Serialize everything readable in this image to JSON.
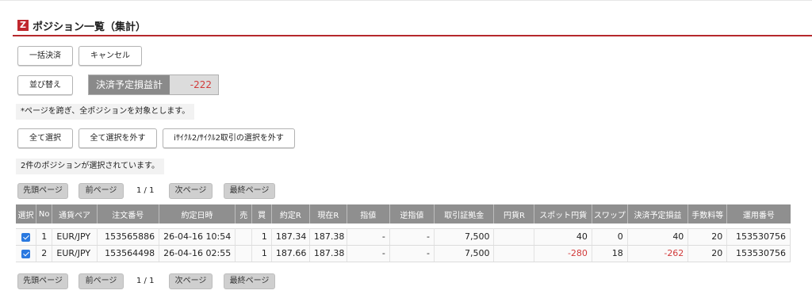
{
  "title": "ポジション一覧（集計）",
  "logo_letter": "Z",
  "buttons": {
    "bulk_settle": "一括決済",
    "cancel": "キャンセル",
    "sort": "並び替え",
    "select_all": "全て選択",
    "deselect_all": "全て選択を外す",
    "deselect_ifd": "iｻｲｸﾙ2/ｻｲｸﾙ2取引の選択を外す"
  },
  "pl_summary": {
    "label": "決済予定損益計",
    "value": "-222"
  },
  "notes": {
    "cross_page": "*ページを跨ぎ、全ポジションを対象とします。",
    "selected_count": "2件のポジションが選択されています。"
  },
  "pager": {
    "first": "先頭ページ",
    "prev": "前ページ",
    "indicator": "1 / 1",
    "next": "次ページ",
    "last": "最終ページ"
  },
  "table": {
    "headers": [
      "選択",
      "No",
      "通貨ペア",
      "注文番号",
      "約定日時",
      "売",
      "買",
      "約定R",
      "現在R",
      "指値",
      "逆指値",
      "取引証拠金",
      "円貨R",
      "スポット円貨",
      "スワップ",
      "決済予定損益",
      "手数料等",
      "運用番号"
    ],
    "rows": [
      {
        "checked": true,
        "no": "1",
        "pair": "EUR/JPY",
        "order_no": "153565886",
        "datetime": "26-04-16 10:54",
        "sell": "",
        "buy": "1",
        "exec_rate": "187.34",
        "current_rate": "187.38",
        "limit": "-",
        "stop": "-",
        "margin": "7,500",
        "yen_rate": "",
        "spot_yen": "40",
        "swap": "0",
        "planned_pl": "40",
        "fee": "20",
        "op_no": "153530756"
      },
      {
        "checked": true,
        "no": "2",
        "pair": "EUR/JPY",
        "order_no": "153564498",
        "datetime": "26-04-16 02:55",
        "sell": "",
        "buy": "1",
        "exec_rate": "187.66",
        "current_rate": "187.38",
        "limit": "-",
        "stop": "-",
        "margin": "7,500",
        "yen_rate": "",
        "spot_yen": "-280",
        "swap": "18",
        "planned_pl": "-262",
        "fee": "20",
        "op_no": "153530756"
      }
    ]
  },
  "colors": {
    "accent": "#c0272d",
    "negative": "#d23a3a",
    "header_bg": "#8f8f8f",
    "checkbox": "#2a79e0"
  }
}
